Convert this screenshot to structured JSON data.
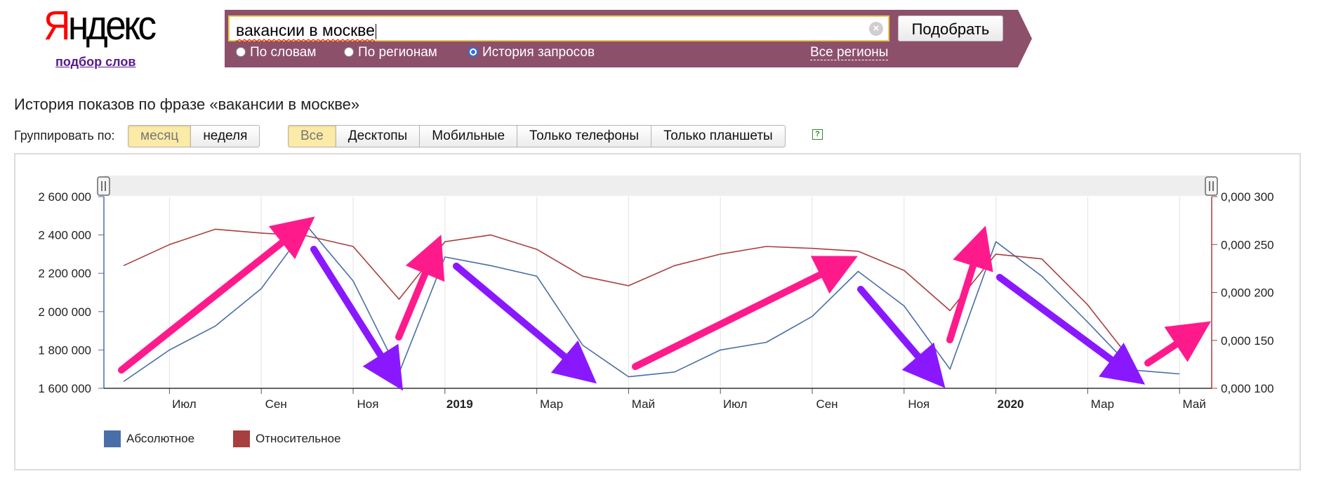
{
  "logo": {
    "first": "Я",
    "rest": "ндекс",
    "subtitle": "подбор слов"
  },
  "search": {
    "query": "вакансии в москве",
    "clear_icon": "clear-icon",
    "submit_label": "Подобрать",
    "modes": [
      {
        "label": "По словам",
        "checked": false
      },
      {
        "label": "По регионам",
        "checked": false
      },
      {
        "label": "История запросов",
        "checked": true
      }
    ],
    "regions_link": "Все регионы"
  },
  "page": {
    "title": "История показов по фразе «вакансии в москве»",
    "group_label": "Группировать по:",
    "group_options": [
      {
        "label": "месяц",
        "active": true
      },
      {
        "label": "неделя",
        "active": false
      }
    ],
    "device_options": [
      {
        "label": "Все",
        "active": true
      },
      {
        "label": "Десктопы",
        "active": false
      },
      {
        "label": "Мобильные",
        "active": false
      },
      {
        "label": "Только телефоны",
        "active": false
      },
      {
        "label": "Только планшеты",
        "active": false
      }
    ],
    "help_icon": "?"
  },
  "colors": {
    "header_bg": "#8d506b",
    "absolute": "#4a6ea8",
    "relative": "#a83f3f",
    "arrow_pink": "#ff1a8c",
    "arrow_purple": "#8a18ff"
  },
  "chart_data": {
    "type": "line",
    "x": [
      "2018-06",
      "2018-07",
      "2018-08",
      "2018-09",
      "2018-10",
      "2018-11",
      "2018-12",
      "2019-01",
      "2019-02",
      "2019-03",
      "2019-04",
      "2019-05",
      "2019-06",
      "2019-07",
      "2019-08",
      "2019-09",
      "2019-10",
      "2019-11",
      "2019-12",
      "2020-01",
      "2020-02",
      "2020-03",
      "2020-04",
      "2020-05"
    ],
    "x_ticks": [
      "Июл",
      "Сен",
      "Ноя",
      "2019",
      "Мар",
      "Май",
      "Июл",
      "Сен",
      "Ноя",
      "2020",
      "Мар",
      "Май"
    ],
    "x_ticks_bold": [
      "2019",
      "2020"
    ],
    "y_left": {
      "range": [
        1600000,
        2600000
      ],
      "ticks": [
        "2 600 000",
        "2 400 000",
        "2 200 000",
        "2 000 000",
        "1 800 000",
        "1 600 000"
      ]
    },
    "y_right": {
      "range": [
        0.0001,
        0.0003
      ],
      "ticks": [
        "0,000 300",
        "0,000 250",
        "0,000 200",
        "0,000 150",
        "0,000 100"
      ]
    },
    "series": [
      {
        "name": "Абсолютное",
        "axis": "left",
        "color": "#4a6ea8",
        "values": [
          1635000,
          1800000,
          1925000,
          2120000,
          2445000,
          2160000,
          1680000,
          2285000,
          2240000,
          2185000,
          1825000,
          1660000,
          1685000,
          1800000,
          1840000,
          1975000,
          2210000,
          2030000,
          1700000,
          2365000,
          2185000,
          1945000,
          1695000,
          1675000
        ]
      },
      {
        "name": "Относительное",
        "axis": "right",
        "color": "#a83f3f",
        "values": [
          0.000228,
          0.00025,
          0.000266,
          0.000262,
          0.000259,
          0.000248,
          0.000193,
          0.000253,
          0.00026,
          0.000245,
          0.000217,
          0.000207,
          0.000228,
          0.00024,
          0.000248,
          0.000246,
          0.000243,
          0.000223,
          0.000181,
          0.00024,
          0.000235,
          0.000187,
          0.000126,
          null
        ]
      }
    ],
    "legend": [
      "Абсолютное",
      "Относительное"
    ],
    "legend_position": "bottom-left",
    "grid": "vertical"
  }
}
